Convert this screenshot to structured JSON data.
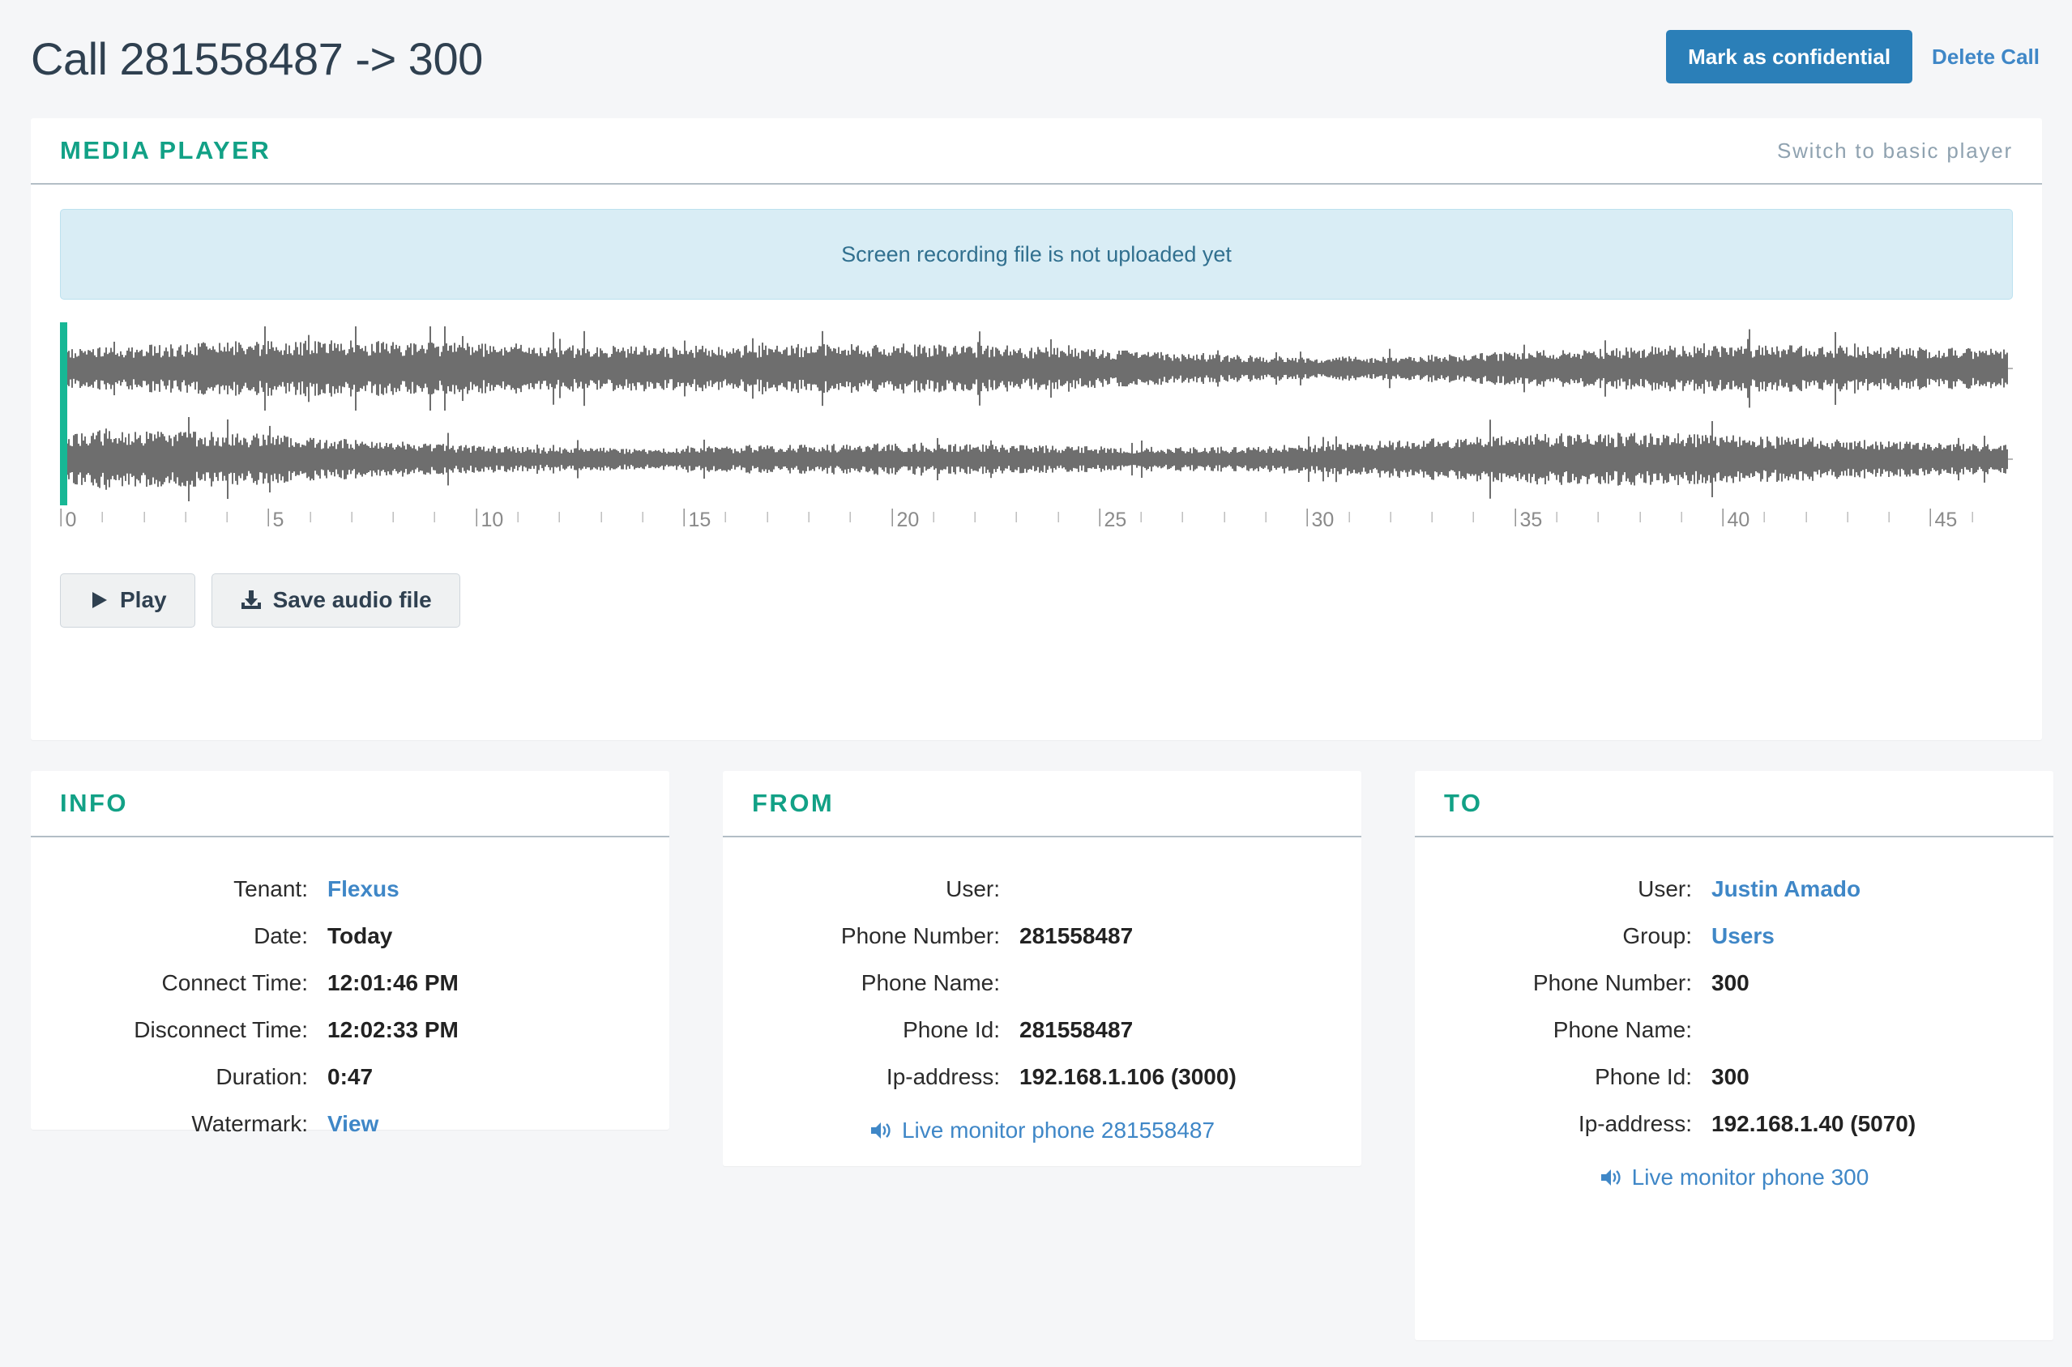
{
  "header": {
    "title": "Call 281558487 -> 300",
    "mark_confidential_label": "Mark as confidential",
    "delete_call_label": "Delete Call",
    "primary_color": "#2b7fb8",
    "link_color": "#3f87c7"
  },
  "media_player": {
    "panel_title": "MEDIA PLAYER",
    "switch_link_label": "Switch to basic player",
    "alert_message": "Screen recording file is not uploaded yet",
    "play_label": "Play",
    "save_label": "Save audio file",
    "accent_color": "#12a186",
    "playhead_color": "#17b795",
    "waveform_color": "#6e6e6e",
    "playhead_position_seconds": 0,
    "ruler": {
      "start": 0,
      "end": 47,
      "major_tick_interval": 5,
      "minor_tick_interval": 1,
      "labels": [
        "0",
        "5",
        "10",
        "15",
        "20",
        "25",
        "30",
        "35",
        "40",
        "45"
      ]
    }
  },
  "info_panel": {
    "title": "INFO",
    "rows": [
      {
        "label": "Tenant:",
        "value": "Flexus",
        "is_link": true
      },
      {
        "label": "Date:",
        "value": "Today",
        "is_link": false
      },
      {
        "label": "Connect Time:",
        "value": "12:01:46 PM",
        "is_link": false
      },
      {
        "label": "Disconnect Time:",
        "value": "12:02:33 PM",
        "is_link": false
      },
      {
        "label": "Duration:",
        "value": "0:47",
        "is_link": false
      },
      {
        "label": "Watermark:",
        "value": "View",
        "is_link": true
      }
    ]
  },
  "from_panel": {
    "title": "FROM",
    "rows": [
      {
        "label": "User:",
        "value": "",
        "is_link": false
      },
      {
        "label": "Phone Number:",
        "value": "281558487",
        "is_link": false
      },
      {
        "label": "Phone Name:",
        "value": "",
        "is_link": false
      },
      {
        "label": "Phone Id:",
        "value": "281558487",
        "is_link": false
      },
      {
        "label": "Ip-address:",
        "value": "192.168.1.106 (3000)",
        "is_link": false
      }
    ],
    "monitor_label": "Live monitor phone 281558487"
  },
  "to_panel": {
    "title": "TO",
    "rows": [
      {
        "label": "User:",
        "value": "Justin Amado",
        "is_link": true
      },
      {
        "label": "Group:",
        "value": "Users",
        "is_link": true
      },
      {
        "label": "Phone Number:",
        "value": "300",
        "is_link": false
      },
      {
        "label": "Phone Name:",
        "value": "",
        "is_link": false
      },
      {
        "label": "Phone Id:",
        "value": "300",
        "is_link": false
      },
      {
        "label": "Ip-address:",
        "value": "192.168.1.40 (5070)",
        "is_link": false
      }
    ],
    "monitor_label": "Live monitor phone 300"
  }
}
